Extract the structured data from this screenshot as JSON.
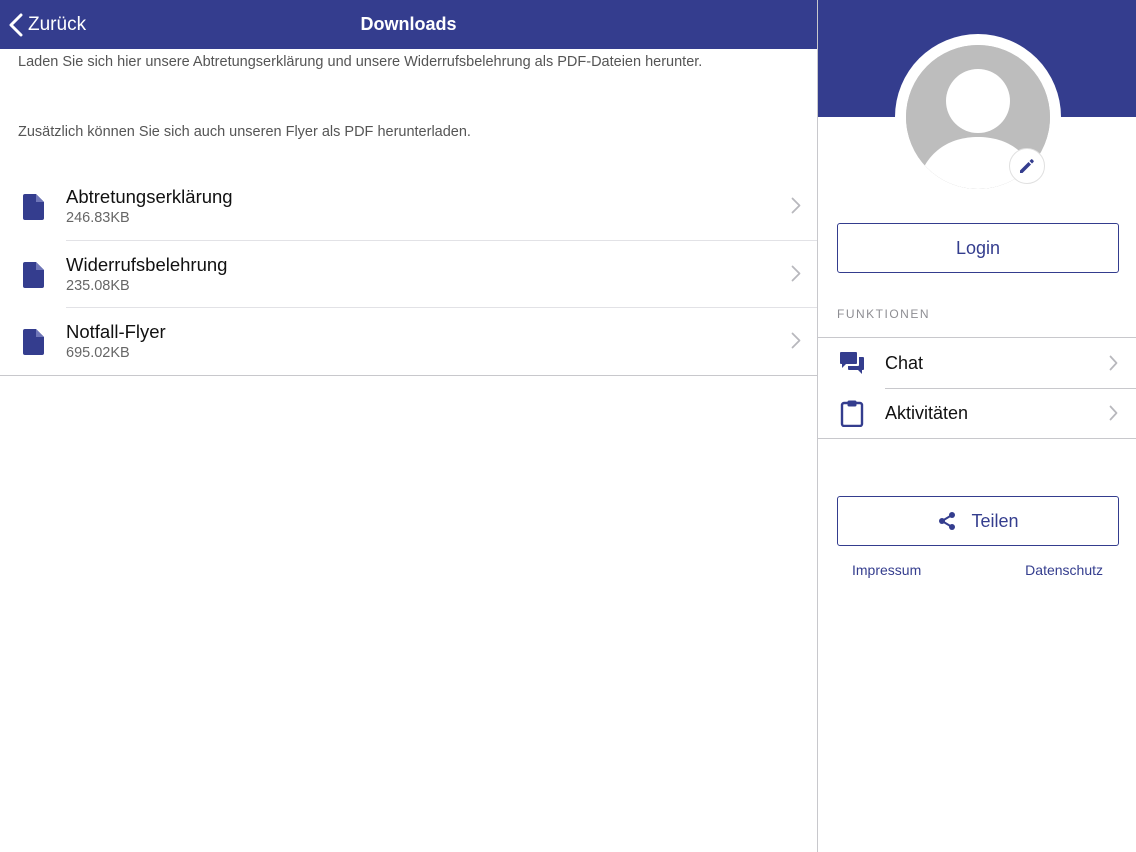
{
  "colors": {
    "brand": "#343d8e",
    "background": "#ffffff",
    "separator": "#c8c8cc",
    "avatar_placeholder": "#bdbdbd"
  },
  "navbar": {
    "back_label": "Zurück",
    "back_icon": "chevron-left-icon",
    "title": "Downloads"
  },
  "intro": {
    "line1": "Laden Sie sich hier unsere Abtretungserklärung und unsere Widerrufsbelehrung als PDF-Dateien herunter.",
    "line2": "Zusätzlich können Sie sich auch unseren Flyer als PDF herunterladen."
  },
  "downloads": [
    {
      "name": "Abtretungserklärung",
      "size": "246.83KB",
      "icon": "file-icon"
    },
    {
      "name": "Widerrufsbelehrung",
      "size": "235.08KB",
      "icon": "file-icon"
    },
    {
      "name": "Notfall-Flyer",
      "size": "695.02KB",
      "icon": "file-icon"
    }
  ],
  "sidebar": {
    "avatar_icon": "user-avatar-icon",
    "edit_icon": "pencil-icon",
    "login_label": "Login",
    "section_label": "FUNKTIONEN",
    "functions": [
      {
        "label": "Chat",
        "icon": "chat-bubbles-icon"
      },
      {
        "label": "Aktivitäten",
        "icon": "clipboard-icon"
      }
    ],
    "share_label": "Teilen",
    "share_icon": "share-icon",
    "impressum_label": "Impressum",
    "datenschutz_label": "Datenschutz"
  }
}
